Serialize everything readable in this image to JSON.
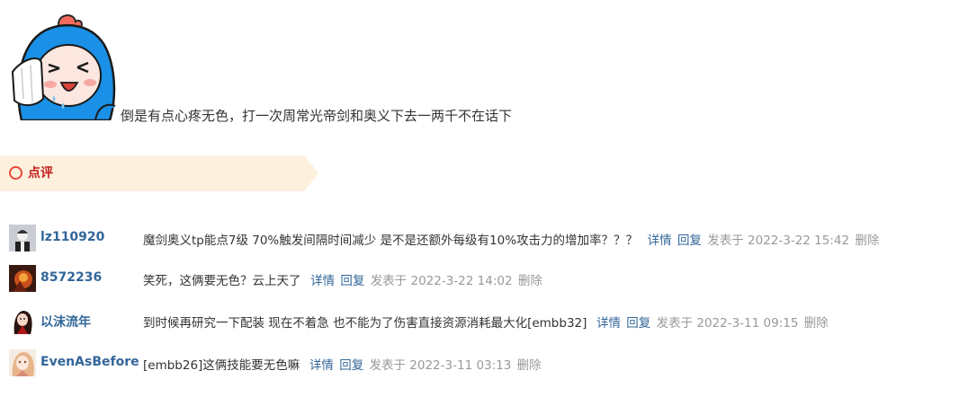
{
  "post": {
    "sticker_icon": "blue-hooded-crying-mascot-sticker",
    "text": "倒是有点心疼无色，打一次周常光帝剑和奥义下去一两千不在话下"
  },
  "review": {
    "label": "点评",
    "icon": "circle-icon",
    "colors": {
      "banner_bg": "#fdf1de",
      "label": "#c2201c",
      "circle": "#e8463c"
    }
  },
  "comments": [
    {
      "user": "lz110920",
      "text": "魔剑奥义tp能点7级 70%触发间隔时间减少 是不是还额外每级有10%攻击力的增加率？？？",
      "detail": "详情",
      "reply": "回复",
      "posted": "发表于 2022-3-22 15:42",
      "delete": "删除"
    },
    {
      "user": "8572236",
      "text": "笑死，这俩要无色？云上天了",
      "detail": "详情",
      "reply": "回复",
      "posted": "发表于 2022-3-22 14:02",
      "delete": "删除"
    },
    {
      "user": "以沫流年",
      "text": "到时候再研究一下配装 现在不着急 也不能为了伤害直接资源消耗最大化[embb32]",
      "detail": "详情",
      "reply": "回复",
      "posted": "发表于 2022-3-11 09:15",
      "delete": "删除"
    },
    {
      "user": "EvenAsBefore",
      "text": "[embb26]这俩技能要无色嘛",
      "detail": "详情",
      "reply": "回复",
      "posted": "发表于 2022-3-11 03:13",
      "delete": "删除"
    }
  ],
  "colors": {
    "link": "#336699",
    "meta": "#999999",
    "text": "#333333"
  }
}
